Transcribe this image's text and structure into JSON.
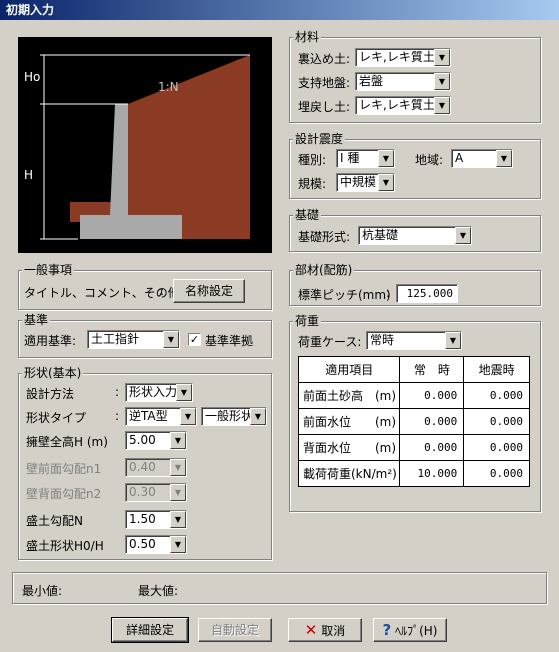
{
  "window": {
    "title": "初期入力"
  },
  "diagram": {
    "label_ho": "Ho",
    "label_h": "H",
    "label_slope": "1:N",
    "colors": {
      "bg": "#000000",
      "soil": "#8b3a24",
      "wall": "#a9a9a9",
      "line": "#ffffff"
    }
  },
  "general": {
    "title": "一般事項",
    "label": "タイトル、コメント、その他",
    "colon": ":",
    "name_button": "名称設定"
  },
  "standard": {
    "title": "基準",
    "label": "適用基準:",
    "value": "土工指針",
    "check_label": "基準準拠",
    "checked": "✓"
  },
  "shape": {
    "title": "形状(基本)",
    "colon": ":",
    "method_label": "設計方法",
    "method_value": "形状入力",
    "type_label": "形状タイプ",
    "type_value": "逆TA型",
    "type_value2": "一般形状",
    "height_label": "擁壁全高H (m)",
    "height_value": "5.00",
    "front_label": "壁前面勾配n1",
    "front_value": "0.40",
    "back_label": "壁背面勾配n2",
    "back_value": "0.30",
    "slope_label": "盛土勾配N",
    "slope_value": "1.50",
    "ratio_label": "盛土形状H0/H",
    "ratio_value": "0.50"
  },
  "material": {
    "title": "材料",
    "backfill_label": "裏込め土:",
    "backfill_value": "レキ,レキ質土,砂",
    "ground_label": "支持地盤:",
    "ground_value": "岩盤",
    "bury_label": "埋戻し土:",
    "bury_value": "レキ,レキ質土,砂"
  },
  "seismic": {
    "title": "設計震度",
    "kind_label": "種別:",
    "kind_value": "I 種",
    "region_label": "地域:",
    "region_value": "A",
    "scale_label": "規模:",
    "scale_value": "中規模"
  },
  "foundation": {
    "title": "基礎",
    "label": "基礎形式:",
    "value": "杭基礎"
  },
  "member": {
    "title": "部材(配筋)",
    "label": "標準ピッチ(mm)",
    "colon": ":",
    "value": "125.000"
  },
  "load": {
    "title": "荷重",
    "case_label": "荷重ケース:",
    "case_value": "常時",
    "columns": [
      "適用項目",
      "常　時",
      "地震時"
    ],
    "rows": [
      {
        "label": "前面土砂高　(m)",
        "normal": "0.000",
        "quake": "0.000"
      },
      {
        "label": "前面水位　　(m)",
        "normal": "0.000",
        "quake": "0.000"
      },
      {
        "label": "背面水位　　(m)",
        "normal": "0.000",
        "quake": "0.000"
      },
      {
        "label": "載荷荷重(kN/m²)",
        "normal": "10.000",
        "quake": "0.000"
      }
    ]
  },
  "status": {
    "min_label": "最小値:",
    "max_label": "最大値:"
  },
  "buttons": {
    "detail": "詳細設定",
    "auto": "自動設定",
    "cancel": "取消",
    "help": "ﾍﾙﾌﾟ(H)"
  }
}
